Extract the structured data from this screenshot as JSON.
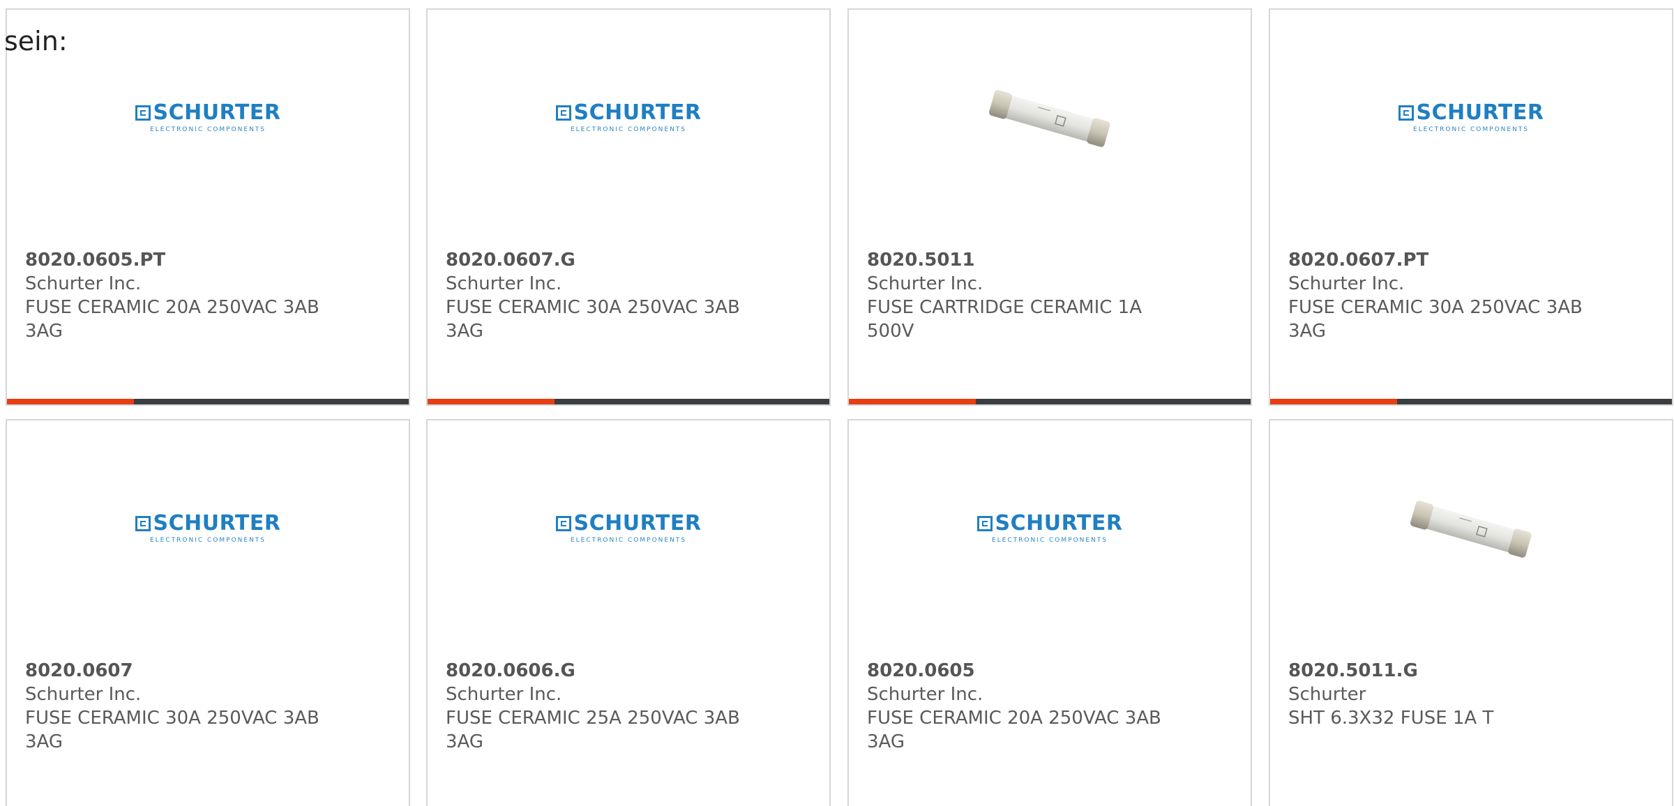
{
  "intro_text": "sein:",
  "logo": {
    "brand": "SCHURTER",
    "tagline": "ELECTRONIC COMPONENTS",
    "color": "#1f7fc2"
  },
  "accent_color": "#e83e14",
  "bar_color": "#3b3e41",
  "products": [
    {
      "part": "8020.0605.PT",
      "maker": "Schurter Inc.",
      "desc": "FUSE CERAMIC 20A 250VAC 3AB 3AG",
      "image": "schurter-logo"
    },
    {
      "part": "8020.0607.G",
      "maker": "Schurter Inc.",
      "desc": "FUSE CERAMIC 30A 250VAC 3AB 3AG",
      "image": "schurter-logo"
    },
    {
      "part": "8020.5011",
      "maker": "Schurter Inc.",
      "desc": "FUSE CARTRIDGE CERAMIC 1A 500V",
      "image": "fuse-photo"
    },
    {
      "part": "8020.0607.PT",
      "maker": "Schurter Inc.",
      "desc": "FUSE CERAMIC 30A 250VAC 3AB 3AG",
      "image": "schurter-logo"
    },
    {
      "part": "8020.0607",
      "maker": "Schurter Inc.",
      "desc": "FUSE CERAMIC 30A 250VAC 3AB 3AG",
      "image": "schurter-logo"
    },
    {
      "part": "8020.0606.G",
      "maker": "Schurter Inc.",
      "desc": "FUSE CERAMIC 25A 250VAC 3AB 3AG",
      "image": "schurter-logo"
    },
    {
      "part": "8020.0605",
      "maker": "Schurter Inc.",
      "desc": "FUSE CERAMIC 20A 250VAC 3AB 3AG",
      "image": "schurter-logo"
    },
    {
      "part": "8020.5011.G",
      "maker": "Schurter",
      "desc": "SHT 6.3X32 FUSE 1A T",
      "image": "fuse-photo"
    }
  ]
}
